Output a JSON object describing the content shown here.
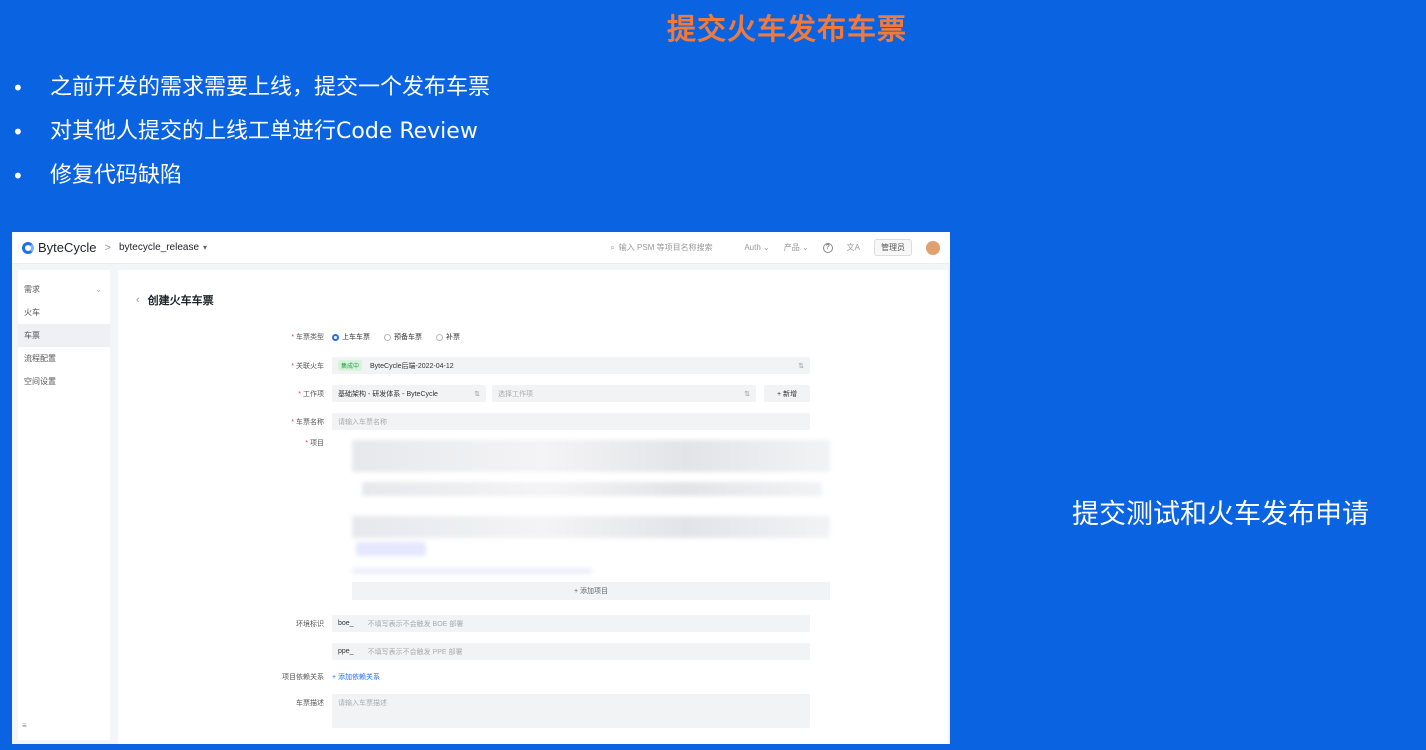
{
  "slide": {
    "title": "提交火车发布车票",
    "bullets": [
      "之前开发的需求需要上线，提交一个发布车票",
      "对其他人提交的上线工单进行Code Review",
      "修复代码缺陷"
    ],
    "side_text": "提交测试和火车发布申请",
    "bullet_glyph": "•"
  },
  "app": {
    "brand": "ByteCycle",
    "breadcrumb_sep": ">",
    "project": "bytecycle_release",
    "search_placeholder": "输入 PSM 等项目名称搜索",
    "menu_1": "Auth",
    "menu_2": "产品",
    "admin_label": "管理员",
    "sidebar": [
      "需求",
      "火车",
      "车票",
      "流程配置",
      "空间设置"
    ],
    "sidebar_active": "车票",
    "sidebar_footer": "≡",
    "page_title": "创建火车车票",
    "back_glyph": "‹",
    "form": {
      "ticket_type_label": "车票类型",
      "ticket_type_options": [
        "上车车票",
        "预备车票",
        "补票"
      ],
      "ticket_type_selected": "上车车票",
      "train_label": "关联火车",
      "train_status_tag": "集成中",
      "train_value": "ByteCycle后端-2022-04-12",
      "workitem_label": "工作项",
      "workitem_value": "基础架构 - 研发体系 - ByteCycle",
      "workitem_placeholder": "选择工作项",
      "workitem_add": "+ 新增",
      "name_label": "车票名称",
      "name_placeholder": "请输入车票名称",
      "project_label": "项目",
      "add_project": "+ 添加项目",
      "env_label": "环境标识",
      "env_boe_prefix": "boe_",
      "env_boe_placeholder": "不填写表示不会触发 BOE 部署",
      "env_ppe_prefix": "ppe_",
      "env_ppe_placeholder": "不填写表示不会触发 PPE 部署",
      "dep_label": "项目依赖关系",
      "dep_link": "+ 添加依赖关系",
      "desc_label": "车票描述",
      "desc_placeholder": "请输入车票描述"
    }
  }
}
